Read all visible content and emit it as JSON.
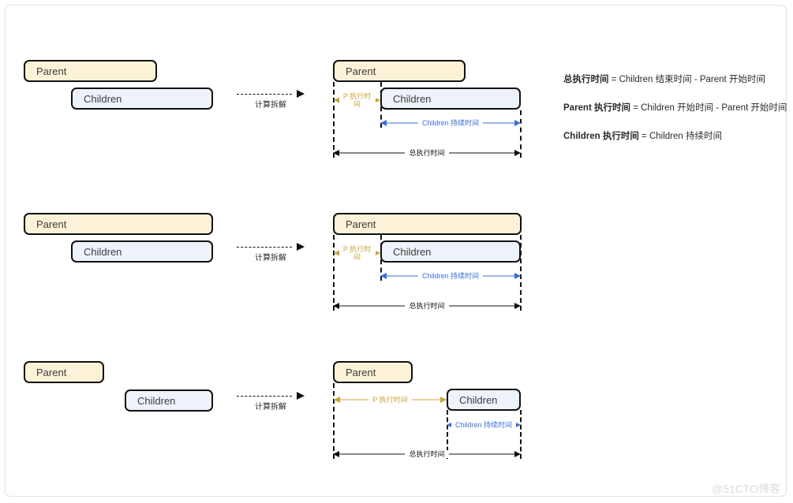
{
  "labels": {
    "parent": "Parent",
    "children": "Children",
    "transition": "计算拆解",
    "p_exec_time": "P 执行时间",
    "children_duration": "Children 持续时间",
    "total_exec_time": "总执行时间"
  },
  "colors": {
    "parent_fill": "#fdf2d7",
    "children_fill": "#eef2fa",
    "box_border": "#111111",
    "gold_arrow": "#c8a33c",
    "blue_arrow": "#3b6fd4",
    "black_arrow": "#111111",
    "frame_border": "#e3e3e3",
    "watermark": "#dcdcdc"
  },
  "formulas": [
    {
      "lhs": "总执行时间",
      "rhs": " = Children 结束时间 - Parent 开始时间"
    },
    {
      "lhs": "Parent 执行时间",
      "rhs": " = Children 开始时间 - Parent 开始时间"
    },
    {
      "lhs": "Children 执行时间",
      "rhs": " = Children 持续时间"
    }
  ],
  "rows": [
    {
      "name": "row-1",
      "left": {
        "parent": "Parent",
        "children": "Children"
      },
      "right": {
        "parent": "Parent",
        "children": "Children",
        "p_exec_time": "P 执行时间",
        "children_duration": "Children 持续时间",
        "total_exec_time": "总执行时间"
      },
      "transition": "计算拆解"
    },
    {
      "name": "row-2",
      "left": {
        "parent": "Parent",
        "children": "Children"
      },
      "right": {
        "parent": "Parent",
        "children": "Children",
        "p_exec_time": "P 执行时间",
        "children_duration": "Children 持续时间",
        "total_exec_time": "总执行时间"
      },
      "transition": "计算拆解"
    },
    {
      "name": "row-3",
      "left": {
        "parent": "Parent",
        "children": "Children"
      },
      "right": {
        "parent": "Parent",
        "children": "Children",
        "p_exec_time": "P 执行时间",
        "children_duration": "Children 持续时间",
        "total_exec_time": "总执行时间"
      },
      "transition": "计算拆解"
    }
  ],
  "watermark": "@51CTO博客"
}
